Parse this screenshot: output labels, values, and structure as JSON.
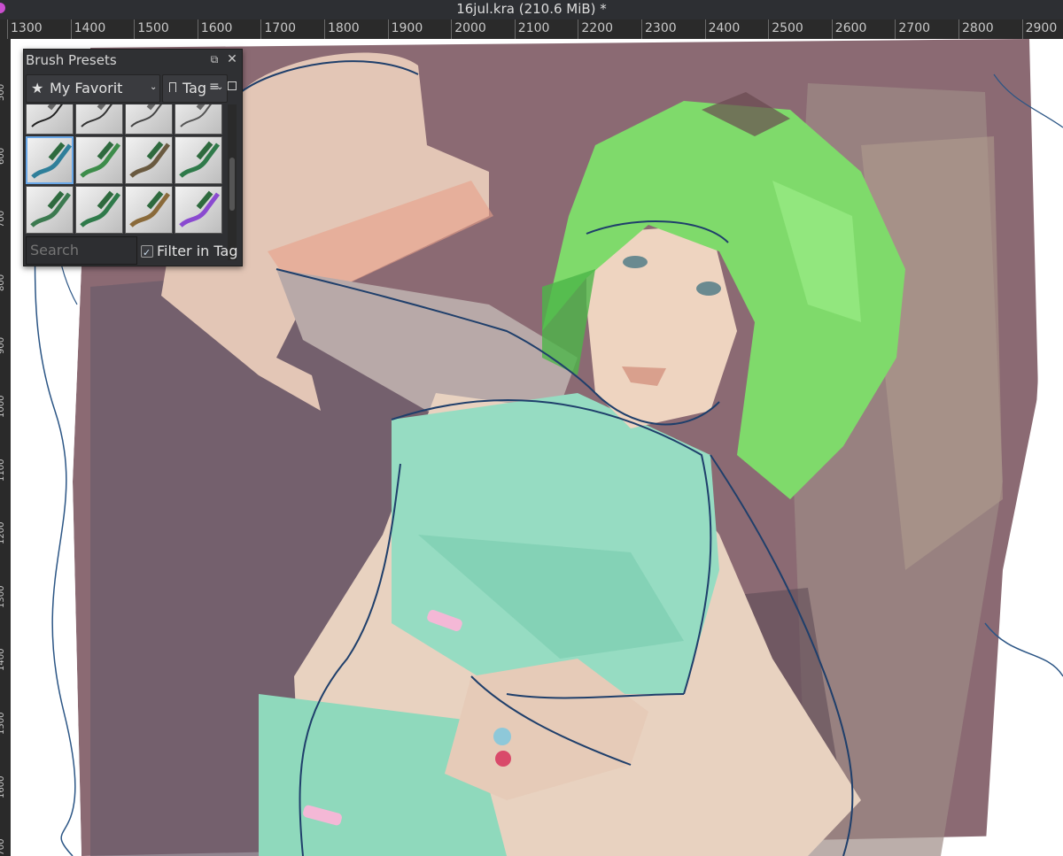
{
  "window": {
    "title": "16jul.kra (210.6 MiB) *"
  },
  "ruler": {
    "horizontal_ticks": [
      "1300",
      "1400",
      "1500",
      "1600",
      "1700",
      "1800",
      "1900",
      "2000",
      "2100",
      "2200",
      "2300",
      "2400",
      "2500",
      "2600",
      "2700",
      "2800",
      "2900"
    ],
    "vertical_ticks": [
      "500",
      "600",
      "700",
      "800",
      "900",
      "1000",
      "1100",
      "1200",
      "1300",
      "1400",
      "1500",
      "1600",
      "1700"
    ]
  },
  "brush_presets": {
    "title": "Brush Presets",
    "float_icon": "float-icon",
    "close_icon": "close-icon",
    "favorites": {
      "icon": "star-icon",
      "label": "My Favorit",
      "chevron": "chevron-down-icon"
    },
    "tag": {
      "icon": "tag-icon",
      "label": "Tag",
      "chevron": "chevron-down-icon"
    },
    "list_view_icon": "list-icon",
    "grid_view_icon": "grid-icon",
    "search_placeholder": "Search",
    "filter_in_tag": {
      "label": "Filter in Tag",
      "checked": true
    },
    "presets": [
      {
        "name": "ink-pen"
      },
      {
        "name": "fineliner"
      },
      {
        "name": "pencil"
      },
      {
        "name": "marker"
      },
      {
        "name": "blender-brush",
        "selected": true
      },
      {
        "name": "bristles-green"
      },
      {
        "name": "bristles-fan"
      },
      {
        "name": "splat-brush"
      },
      {
        "name": "texture-brush"
      },
      {
        "name": "chalk-brush"
      },
      {
        "name": "flat-brush"
      },
      {
        "name": "glow-brush"
      }
    ]
  },
  "colors": {
    "background_wall": "#8a6c75",
    "shadow_wall": "#6f5d68",
    "hair": "#7fdc6a",
    "top": "#8fd9bc",
    "skin": "#ecd6c0",
    "lineart": "#1f3f6b"
  }
}
